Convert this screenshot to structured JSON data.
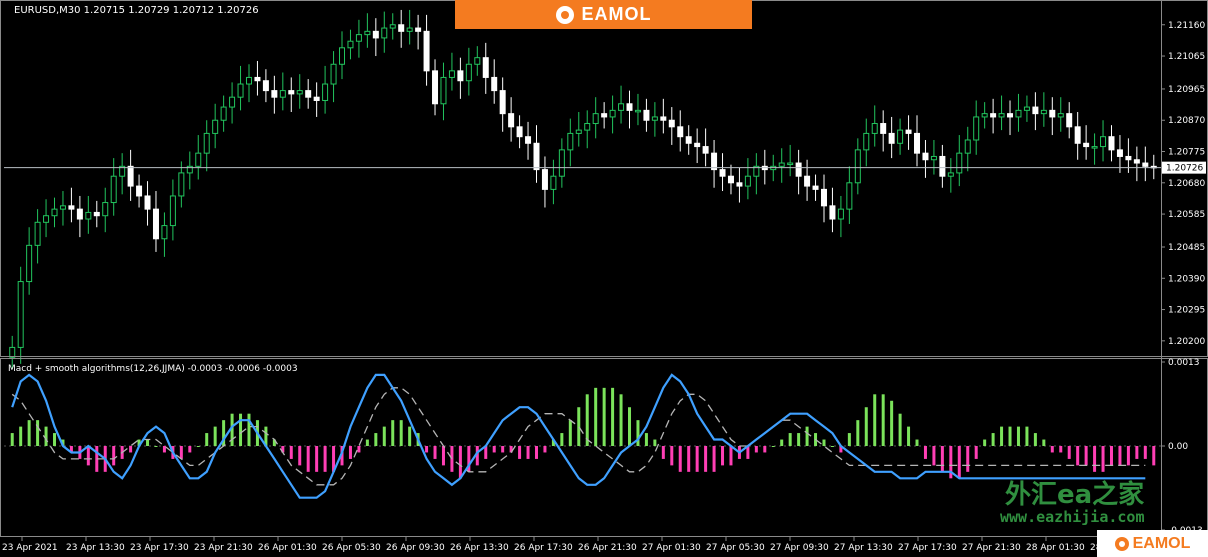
{
  "header": {
    "symbol_info": "EURUSD,M30  1.20715 1.20729 1.20712 1.20726",
    "banner_text": "EAMOL"
  },
  "indicator": {
    "label": "Macd + smooth algorithms(12,26,JJMA) -0.0003 -0.0006 -0.0003"
  },
  "watermark": {
    "cn": "外汇ea之家",
    "url": "www.eazhijia.com",
    "bottom_logo": "EAMOL"
  },
  "colors": {
    "background": "#000000",
    "bull": "#22c55e",
    "bear": "#ffffff",
    "hist_pos": "#7be35b",
    "hist_neg": "#ff3fb5",
    "macd_line": "#3fa0ff",
    "signal_line": "#b5b5b5",
    "price_line": "#b9bfc5",
    "brand": "#f47b20"
  },
  "chart_data": [
    {
      "type": "candlestick",
      "title": "EURUSD,M30",
      "current_price": 1.20726,
      "price_label": "1.20726",
      "ylim": [
        1.2016,
        1.2122
      ],
      "y_ticks": [
        "1.21160",
        "1.21065",
        "1.20965",
        "1.20870",
        "1.20775",
        "1.20680",
        "1.20585",
        "1.20485",
        "1.20390",
        "1.20295",
        "1.20200"
      ],
      "x_ticks": [
        "23 Apr 2021",
        "23 Apr 13:30",
        "23 Apr 17:30",
        "23 Apr 21:30",
        "26 Apr 01:30",
        "26 Apr 05:30",
        "26 Apr 09:30",
        "26 Apr 13:30",
        "26 Apr 17:30",
        "26 Apr 21:30",
        "27 Apr 01:30",
        "27 Apr 05:30",
        "27 Apr 09:30",
        "27 Apr 13:30",
        "27 Apr 17:30",
        "27 Apr 21:30",
        "28 Apr 01:30",
        "28 Apr 05:30",
        "28"
      ],
      "close": [
        1.2018,
        1.2038,
        1.2049,
        1.2056,
        1.2058,
        1.206,
        1.2061,
        1.206,
        1.2057,
        1.2059,
        1.2058,
        1.2062,
        1.207,
        1.2073,
        1.2067,
        1.2064,
        1.206,
        1.2051,
        1.2055,
        1.2064,
        1.2071,
        1.2073,
        1.2077,
        1.2083,
        1.2087,
        1.2091,
        1.2094,
        1.2098,
        1.21,
        1.2099,
        1.2096,
        1.2094,
        1.2096,
        1.2095,
        1.2096,
        1.2094,
        1.2093,
        1.2098,
        1.2104,
        1.2109,
        1.2111,
        1.2113,
        1.2114,
        1.2112,
        1.2115,
        1.2116,
        1.2114,
        1.2115,
        1.2114,
        1.2102,
        1.2092,
        1.21,
        1.2102,
        1.2099,
        1.2104,
        1.2106,
        1.21,
        1.2096,
        1.2089,
        1.2085,
        1.2082,
        1.208,
        1.2072,
        1.2066,
        1.207,
        1.2078,
        1.2083,
        1.2084,
        1.2086,
        1.2089,
        1.2088,
        1.209,
        1.2092,
        1.209,
        1.209,
        1.2087,
        1.2088,
        1.2087,
        1.2085,
        1.2082,
        1.208,
        1.2079,
        1.2077,
        1.2072,
        1.207,
        1.2068,
        1.2067,
        1.207,
        1.2073,
        1.2072,
        1.2073,
        1.2074,
        1.2074,
        1.207,
        1.2067,
        1.2066,
        1.2061,
        1.2057,
        1.206,
        1.2068,
        1.2078,
        1.2083,
        1.2086,
        1.2083,
        1.208,
        1.2084,
        1.2083,
        1.2077,
        1.2075,
        1.2076,
        1.207,
        1.2071,
        1.2077,
        1.2081,
        1.2088,
        1.2089,
        1.2088,
        1.2089,
        1.2088,
        1.209,
        1.2091,
        1.2089,
        1.209,
        1.2088,
        1.2089,
        1.2085,
        1.208,
        1.2079,
        1.2079,
        1.2082,
        1.2078,
        1.2076,
        1.2075,
        1.2074,
        1.2073,
        1.20726
      ],
      "colors_legend": "green = bullish, white = bearish"
    },
    {
      "type": "bar+line",
      "title": "Macd + smooth algorithms(12,26,JJMA)",
      "values_label": "-0.0003 -0.0006 -0.0003",
      "ylim": [
        -0.0013,
        0.0013
      ],
      "y_ticks": [
        "0.0013",
        "0.00",
        "-0.0013"
      ],
      "histogram": [
        0.0002,
        0.0003,
        0.0004,
        0.0004,
        0.0003,
        0.0002,
        0.0001,
        -0.0001,
        -0.0002,
        -0.0003,
        -0.0004,
        -0.0004,
        -0.0003,
        -0.0002,
        -0.0001,
        0.0001,
        0.0001,
        0.0,
        -0.0001,
        -0.0002,
        -0.0002,
        -0.0001,
        0.0,
        0.0002,
        0.0003,
        0.0004,
        0.0005,
        0.0005,
        0.0005,
        0.0004,
        0.0003,
        0.0001,
        -0.0001,
        -0.0002,
        -0.0003,
        -0.0004,
        -0.0004,
        -0.0004,
        -0.0004,
        -0.0003,
        -0.0002,
        -0.0001,
        0.0001,
        0.0002,
        0.0003,
        0.0004,
        0.0004,
        0.0003,
        0.0002,
        -0.0001,
        -0.0002,
        -0.0003,
        -0.0004,
        -0.0005,
        -0.0004,
        -0.0003,
        -0.0002,
        -0.0001,
        -0.0001,
        -0.0001,
        -0.0002,
        -0.0002,
        -0.0002,
        -0.0001,
        0.0001,
        0.0002,
        0.0004,
        0.0006,
        0.0008,
        0.0009,
        0.0009,
        0.0009,
        0.0008,
        0.0006,
        0.0004,
        0.0002,
        0.0001,
        -0.0002,
        -0.0003,
        -0.0004,
        -0.0004,
        -0.0004,
        -0.0004,
        -0.0004,
        -0.0003,
        -0.0003,
        -0.0002,
        -0.0002,
        -0.0001,
        -0.0001,
        0.0,
        0.0001,
        0.0002,
        0.0002,
        0.0003,
        0.0002,
        0.0001,
        0.0,
        -0.0001,
        0.0002,
        0.0004,
        0.0006,
        0.0008,
        0.0008,
        0.0007,
        0.0005,
        0.0003,
        0.0001,
        -0.0002,
        -0.0003,
        -0.0004,
        -0.0005,
        -0.0005,
        -0.0004,
        -0.0002,
        0.0001,
        0.0002,
        0.0003,
        0.0003,
        0.0003,
        0.0003,
        0.0002,
        0.0001,
        -0.0001,
        -0.0001,
        -0.0002,
        -0.0003,
        -0.0003,
        -0.0004,
        -0.0004,
        -0.0003,
        -0.0003,
        -0.0003,
        -0.0002,
        -0.0002,
        -0.0003
      ],
      "macd": [
        0.0006,
        0.001,
        0.0011,
        0.001,
        0.0007,
        0.0003,
        0.0,
        -0.0001,
        -0.0001,
        0.0,
        -0.0001,
        -0.0002,
        -0.0004,
        -0.0005,
        -0.0003,
        0.0,
        0.0002,
        0.0003,
        0.0002,
        -0.0001,
        -0.0003,
        -0.0005,
        -0.0005,
        -0.0004,
        -0.0001,
        0.0001,
        0.0003,
        0.0004,
        0.0004,
        0.0002,
        0.0,
        -0.0002,
        -0.0004,
        -0.0006,
        -0.0008,
        -0.0008,
        -0.0008,
        -0.0007,
        -0.0004,
        -0.0001,
        0.0003,
        0.0006,
        0.0009,
        0.0011,
        0.0011,
        0.0009,
        0.0007,
        0.0004,
        0.0001,
        -0.0002,
        -0.0004,
        -0.0005,
        -0.0006,
        -0.0005,
        -0.0003,
        -0.0001,
        0.0,
        0.0002,
        0.0004,
        0.0005,
        0.0006,
        0.0006,
        0.0005,
        0.0003,
        0.0001,
        -0.0001,
        -0.0003,
        -0.0005,
        -0.0006,
        -0.0006,
        -0.0005,
        -0.0003,
        -0.0001,
        0.0,
        0.0001,
        0.0003,
        0.0006,
        0.0009,
        0.0011,
        0.001,
        0.0008,
        0.0005,
        0.0003,
        0.0001,
        0.0001,
        0.0,
        -0.0001,
        0.0,
        0.0001,
        0.0002,
        0.0003,
        0.0004,
        0.0005,
        0.0005,
        0.0005,
        0.0004,
        0.0003,
        0.0002,
        0.0,
        -0.0001,
        -0.0002,
        -0.0003,
        -0.0004,
        -0.0004,
        -0.0004,
        -0.0005,
        -0.0005,
        -0.0005,
        -0.0004,
        -0.0004,
        -0.0004,
        -0.0004,
        -0.0005,
        -0.0005,
        -0.0005,
        -0.0005,
        -0.0005,
        -0.0005,
        -0.0005,
        -0.0005,
        -0.0005,
        -0.0005,
        -0.0005,
        -0.0005,
        -0.0005,
        -0.0005,
        -0.0005,
        -0.0005,
        -0.0005,
        -0.0005,
        -0.0005,
        -0.0005,
        -0.0005,
        -0.0005,
        -0.0005
      ],
      "signal": [
        0.0008,
        0.0007,
        0.0005,
        0.0003,
        0.0001,
        -0.0001,
        -0.0002,
        -0.0002,
        -0.0002,
        -0.0002,
        -0.0002,
        -0.0002,
        -0.0002,
        -0.0001,
        0.0,
        0.0001,
        0.0001,
        0.0001,
        0.0,
        -0.0001,
        -0.0002,
        -0.0003,
        -0.0003,
        -0.0002,
        -0.0001,
        0.0,
        0.0001,
        0.0002,
        0.0003,
        0.0003,
        0.0002,
        0.0001,
        -0.0001,
        -0.0003,
        -0.0004,
        -0.0005,
        -0.0006,
        -0.0006,
        -0.0006,
        -0.0005,
        -0.0003,
        0.0,
        0.0003,
        0.0006,
        0.0008,
        0.0009,
        0.0009,
        0.0008,
        0.0006,
        0.0004,
        0.0002,
        0.0,
        -0.0002,
        -0.0003,
        -0.0004,
        -0.0004,
        -0.0004,
        -0.0003,
        -0.0002,
        -0.0001,
        0.0001,
        0.0003,
        0.0004,
        0.0005,
        0.0005,
        0.0005,
        0.0004,
        0.0003,
        0.0001,
        0.0,
        -0.0001,
        -0.0002,
        -0.0003,
        -0.0004,
        -0.0004,
        -0.0003,
        -0.0001,
        0.0002,
        0.0005,
        0.0007,
        0.0008,
        0.0008,
        0.0007,
        0.0005,
        0.0003,
        0.0001,
        0.0,
        0.0,
        0.0001,
        0.0002,
        0.0003,
        0.0004,
        0.0004,
        0.0003,
        0.0002,
        0.0001,
        0.0,
        -0.0001,
        -0.0002,
        -0.0003,
        -0.0003,
        -0.0003,
        -0.0003,
        -0.0003,
        -0.0003,
        -0.0003,
        -0.0003,
        -0.0003,
        -0.0003,
        -0.0003,
        -0.0003,
        -0.0003,
        -0.0003,
        -0.0003,
        -0.0003,
        -0.0003,
        -0.0003,
        -0.0003,
        -0.0003,
        -0.0003,
        -0.0003,
        -0.0003,
        -0.0003,
        -0.0003,
        -0.0003,
        -0.0003,
        -0.0003,
        -0.0003,
        -0.0003,
        -0.0003,
        -0.0003,
        -0.0003,
        -0.0003,
        -0.0003,
        -0.0003
      ]
    }
  ]
}
